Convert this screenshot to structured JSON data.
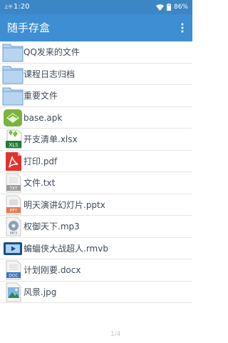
{
  "status_bar": {
    "time_prefix": "上午",
    "time": "1:20",
    "battery": "86%"
  },
  "app_bar": {
    "title": "随手存盒",
    "menu_icon": "more-vert-icon"
  },
  "files": [
    {
      "name": "QQ发来的文件",
      "icon": "folder-icon"
    },
    {
      "name": "课程日志归档",
      "icon": "folder-icon"
    },
    {
      "name": "重要文件",
      "icon": "folder-icon"
    },
    {
      "name": "base.apk",
      "icon": "apk-file-icon"
    },
    {
      "name": "开支清单.xlsx",
      "icon": "xlsx-file-icon"
    },
    {
      "name": "打印.pdf",
      "icon": "pdf-file-icon"
    },
    {
      "name": "文件.txt",
      "icon": "txt-file-icon"
    },
    {
      "name": "明天演讲幻灯片.pptx",
      "icon": "ppt-file-icon"
    },
    {
      "name": "权御天下.mp3",
      "icon": "mp3-file-icon"
    },
    {
      "name": "蝙蝠侠大战超人.rmvb",
      "icon": "video-file-icon"
    },
    {
      "name": "计划刚要.docx",
      "icon": "doc-file-icon"
    },
    {
      "name": "风景.jpg",
      "icon": "image-file-icon"
    }
  ],
  "page_indicator": "1/4",
  "colors": {
    "status_bar": "#3b87c6",
    "app_bar": "#3d8ed2",
    "text": "#3f4b5a"
  }
}
